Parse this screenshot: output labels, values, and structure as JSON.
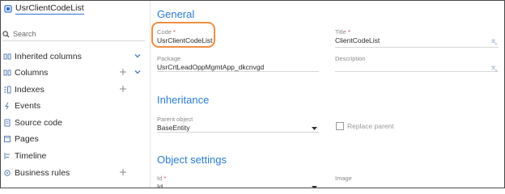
{
  "sidebar": {
    "object_name": "UsrClientCodeList",
    "search": {
      "placeholder": "Search",
      "value": ""
    },
    "items": [
      {
        "label": "Inherited columns",
        "icon": "grid-columns-icon",
        "add": false,
        "expand": true
      },
      {
        "label": "Columns",
        "icon": "grid-columns-icon",
        "add": true,
        "expand": true
      },
      {
        "label": "Indexes",
        "icon": "indexes-icon",
        "add": true,
        "expand": false
      },
      {
        "label": "Events",
        "icon": "lightning-icon",
        "add": false,
        "expand": false
      },
      {
        "label": "Source code",
        "icon": "document-icon",
        "add": false,
        "expand": false
      },
      {
        "label": "Pages",
        "icon": "page-icon",
        "add": false,
        "expand": false
      },
      {
        "label": "Timeline",
        "icon": "timeline-icon",
        "add": false,
        "expand": false
      },
      {
        "label": "Business rules",
        "icon": "business-rules-icon",
        "add": true,
        "expand": false
      }
    ]
  },
  "main": {
    "general": {
      "title": "General",
      "code": {
        "label": "Code",
        "required": "*",
        "value": "UsrClientCodeList"
      },
      "title_field": {
        "label": "Title",
        "required": "*",
        "value": "ClientCodeList"
      },
      "package": {
        "label": "Package",
        "value": "UsrCrtLeadOppMgmtApp_dkcnvgd"
      },
      "description": {
        "label": "Description",
        "value": ""
      }
    },
    "inheritance": {
      "title": "Inheritance",
      "parent_object": {
        "label": "Parent object",
        "value": "BaseEntity"
      },
      "replace_parent": {
        "label": "Replace parent",
        "checked": false
      }
    },
    "object_settings": {
      "title": "Object settings",
      "id": {
        "label": "Id",
        "required": "*",
        "value": "Id"
      },
      "image": {
        "label": "Image",
        "value": ""
      }
    }
  },
  "colors": {
    "accent": "#2a7bd1",
    "highlight": "#ee8d43",
    "required": "#e43a3a",
    "icon": "#5b7fb5"
  }
}
